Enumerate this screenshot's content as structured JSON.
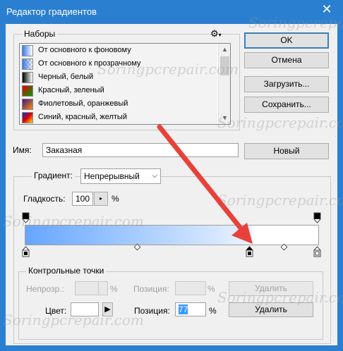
{
  "window": {
    "title": "Редактор градиентов",
    "close_glyph": "✕"
  },
  "presets": {
    "label": "Наборы",
    "items": [
      {
        "label": "От основного к фоновому"
      },
      {
        "label": "От основного к прозрачному"
      },
      {
        "label": "Черный, белый"
      },
      {
        "label": "Красный, зеленый"
      },
      {
        "label": "Фиолетовый, оранжевый"
      },
      {
        "label": "Синий, красный, желтый"
      }
    ]
  },
  "buttons": {
    "ok": "OK",
    "cancel": "Отмена",
    "load": "Загрузить...",
    "save": "Сохранить...",
    "new": "Новый",
    "delete_opacity": "Удалить",
    "delete_color": "Удалить"
  },
  "name_field": {
    "label": "Имя:",
    "value": "Заказная"
  },
  "gradient": {
    "type_label": "Градиент:",
    "type_value": "Непрерывный",
    "smoothness_label": "Гладкость:",
    "smoothness_value": "100",
    "smoothness_unit": "%"
  },
  "stops": {
    "group_label": "Контрольные точки",
    "opacity_label": "Непрозр.:",
    "opacity_value": "",
    "opacity_unit": "%",
    "opacity_position_label": "Позиция:",
    "opacity_position_value": "",
    "opacity_position_unit": "%",
    "color_label": "Цвет:",
    "color_position_label": "Позиция:",
    "color_position_value": "77",
    "color_position_unit": "%"
  },
  "watermark": "Soringpcrepair.com",
  "colors": {
    "title_bar": "#2b7fd1",
    "gradient_start": "#66a6ff",
    "gradient_end": "#ffffff",
    "arrow": "#e8413a"
  }
}
